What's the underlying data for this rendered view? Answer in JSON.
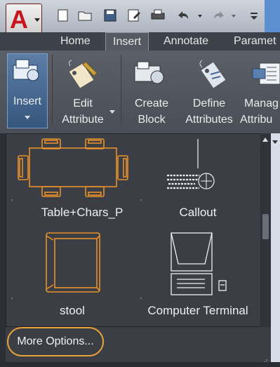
{
  "app": {
    "logo_text": "A"
  },
  "quick_access": {
    "icons": [
      "new-file-icon",
      "open-folder-icon",
      "save-icon",
      "save-as-icon",
      "print-icon",
      "undo-icon",
      "redo-icon",
      "customize-dropdown-icon"
    ]
  },
  "tabs": [
    {
      "label": "Home"
    },
    {
      "label": "Insert"
    },
    {
      "label": "Annotate"
    },
    {
      "label": "Paramet"
    }
  ],
  "ribbon": {
    "insert": {
      "label": "Insert"
    },
    "edit_attribute": {
      "line1": "Edit",
      "line2": "Attribute"
    },
    "create_block": {
      "line1": "Create",
      "line2": "Block"
    },
    "define_attributes": {
      "line1": "Define",
      "line2": "Attributes"
    },
    "manage_attributes": {
      "line1": "Manag",
      "line2": "Attribu"
    }
  },
  "gallery": {
    "items": [
      {
        "label": "Table+Chars_P"
      },
      {
        "label": "Callout"
      },
      {
        "label": "stool"
      },
      {
        "label": "Computer Terminal"
      }
    ]
  },
  "footer": {
    "more_options": "More Options..."
  },
  "colors": {
    "block_orange": "#e8922a",
    "accent_highlight": "#e8a33a",
    "ribbon_bg": "#4f535b",
    "gallery_bg": "#3b3e45"
  }
}
